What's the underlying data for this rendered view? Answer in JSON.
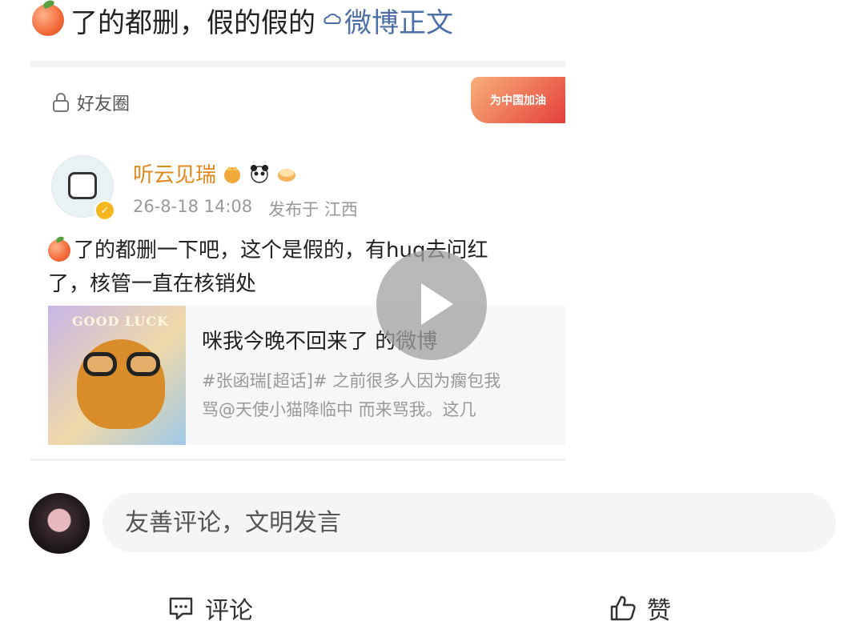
{
  "top": {
    "peach_icon": "peach-emoji-icon",
    "text": "了的都删，假的假的",
    "link_icon": "weibo-link-icon",
    "link_label": "微博正文"
  },
  "card": {
    "visibility_label": "好友圈",
    "badge_text": "为中国加油",
    "author": {
      "name": "听云见瑞",
      "timestamp": "26-8-18 14:08",
      "location": "发布于 江西",
      "emoji_icons": [
        "crown-emoji-icon",
        "panda-emoji-icon",
        "cake-emoji-icon"
      ]
    },
    "post_text_line1": "了的都删一下吧，这个是假的，有huq去问红",
    "post_text_line2": "了，核管一直在核销处",
    "shared": {
      "thumb_text": "GOOD LUCK",
      "title": "咪我今晚不回来了 的微博",
      "desc_line1": "#张函瑞[超话]# 之前很多人因为瘸包我",
      "desc_line2": "骂@天使小猫降临中 而来骂我。这几"
    }
  },
  "comment": {
    "placeholder": "友善评论，文明发言"
  },
  "actions": {
    "comment_label": "评论",
    "like_label": "赞"
  },
  "colors": {
    "link": "#4d6fa8",
    "username": "#e08a1e",
    "meta": "#999999"
  }
}
